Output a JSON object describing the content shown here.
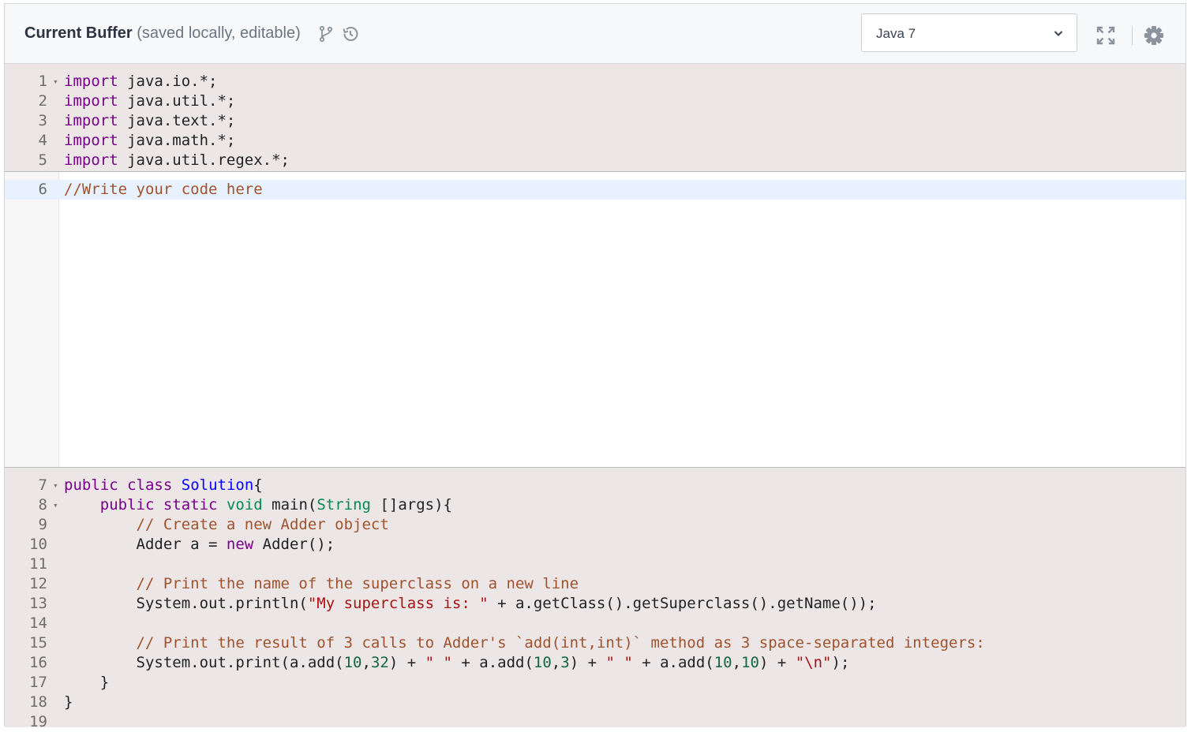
{
  "header": {
    "title": "Current Buffer",
    "subtitle": "(saved locally, editable)",
    "icons": [
      "branch-icon",
      "history-icon",
      "fullscreen-icon",
      "settings-icon"
    ],
    "language": "Java 7"
  },
  "editor": {
    "top_lines": [
      {
        "n": "1",
        "fold": "▾",
        "tokens": [
          {
            "c": "kw",
            "t": "import"
          },
          {
            "c": "",
            "t": " java.io.*;"
          }
        ]
      },
      {
        "n": "2",
        "fold": "",
        "tokens": [
          {
            "c": "kw",
            "t": "import"
          },
          {
            "c": "",
            "t": " java.util.*;"
          }
        ]
      },
      {
        "n": "3",
        "fold": "",
        "tokens": [
          {
            "c": "kw",
            "t": "import"
          },
          {
            "c": "",
            "t": " java.text.*;"
          }
        ]
      },
      {
        "n": "4",
        "fold": "",
        "tokens": [
          {
            "c": "kw",
            "t": "import"
          },
          {
            "c": "",
            "t": " java.math.*;"
          }
        ]
      },
      {
        "n": "5",
        "fold": "",
        "tokens": [
          {
            "c": "kw",
            "t": "import"
          },
          {
            "c": "",
            "t": " java.util.regex.*;"
          }
        ]
      }
    ],
    "edit_lines": [
      {
        "n": "6",
        "fold": "",
        "tokens": [
          {
            "c": "cm",
            "t": "//Write your code here"
          }
        ]
      }
    ],
    "bottom_lines": [
      {
        "n": "7",
        "fold": "▾",
        "tokens": [
          {
            "c": "kw",
            "t": "public"
          },
          {
            "c": "",
            "t": " "
          },
          {
            "c": "kw",
            "t": "class"
          },
          {
            "c": "",
            "t": " "
          },
          {
            "c": "def",
            "t": "Solution"
          },
          {
            "c": "",
            "t": "{"
          }
        ]
      },
      {
        "n": "8",
        "fold": "▾",
        "tokens": [
          {
            "c": "",
            "t": "    "
          },
          {
            "c": "kw",
            "t": "public"
          },
          {
            "c": "",
            "t": " "
          },
          {
            "c": "kw",
            "t": "static"
          },
          {
            "c": "",
            "t": " "
          },
          {
            "c": "ty",
            "t": "void"
          },
          {
            "c": "",
            "t": " main("
          },
          {
            "c": "ty",
            "t": "String"
          },
          {
            "c": "",
            "t": " []args){"
          }
        ]
      },
      {
        "n": "9",
        "fold": "",
        "tokens": [
          {
            "c": "",
            "t": "        "
          },
          {
            "c": "cm",
            "t": "// Create a new Adder object"
          }
        ]
      },
      {
        "n": "10",
        "fold": "",
        "tokens": [
          {
            "c": "",
            "t": "        Adder a = "
          },
          {
            "c": "kw",
            "t": "new"
          },
          {
            "c": "",
            "t": " Adder();"
          }
        ]
      },
      {
        "n": "11",
        "fold": "",
        "tokens": []
      },
      {
        "n": "12",
        "fold": "",
        "tokens": [
          {
            "c": "",
            "t": "        "
          },
          {
            "c": "cm",
            "t": "// Print the name of the superclass on a new line"
          }
        ]
      },
      {
        "n": "13",
        "fold": "",
        "tokens": [
          {
            "c": "",
            "t": "        System.out.println("
          },
          {
            "c": "st",
            "t": "\"My superclass is: \""
          },
          {
            "c": "",
            "t": " + a.getClass().getSuperclass().getName());"
          }
        ]
      },
      {
        "n": "14",
        "fold": "",
        "tokens": []
      },
      {
        "n": "15",
        "fold": "",
        "tokens": [
          {
            "c": "",
            "t": "        "
          },
          {
            "c": "cm",
            "t": "// Print the result of 3 calls to Adder's `add(int,int)` method as 3 space-separated integers:"
          }
        ]
      },
      {
        "n": "16",
        "fold": "",
        "tokens": [
          {
            "c": "",
            "t": "        System.out.print(a.add("
          },
          {
            "c": "nu",
            "t": "10"
          },
          {
            "c": "",
            "t": ","
          },
          {
            "c": "nu",
            "t": "32"
          },
          {
            "c": "",
            "t": ") + "
          },
          {
            "c": "st",
            "t": "\" \""
          },
          {
            "c": "",
            "t": " + a.add("
          },
          {
            "c": "nu",
            "t": "10"
          },
          {
            "c": "",
            "t": ","
          },
          {
            "c": "nu",
            "t": "3"
          },
          {
            "c": "",
            "t": ") + "
          },
          {
            "c": "st",
            "t": "\" \""
          },
          {
            "c": "",
            "t": " + a.add("
          },
          {
            "c": "nu",
            "t": "10"
          },
          {
            "c": "",
            "t": ","
          },
          {
            "c": "nu",
            "t": "10"
          },
          {
            "c": "",
            "t": ") + "
          },
          {
            "c": "st",
            "t": "\"\\n\""
          },
          {
            "c": "",
            "t": ");"
          }
        ]
      },
      {
        "n": "17",
        "fold": "",
        "tokens": [
          {
            "c": "",
            "t": "    }"
          }
        ]
      },
      {
        "n": "18",
        "fold": "",
        "tokens": [
          {
            "c": "",
            "t": "}"
          }
        ]
      },
      {
        "n": "19",
        "fold": "",
        "tokens": []
      }
    ]
  }
}
